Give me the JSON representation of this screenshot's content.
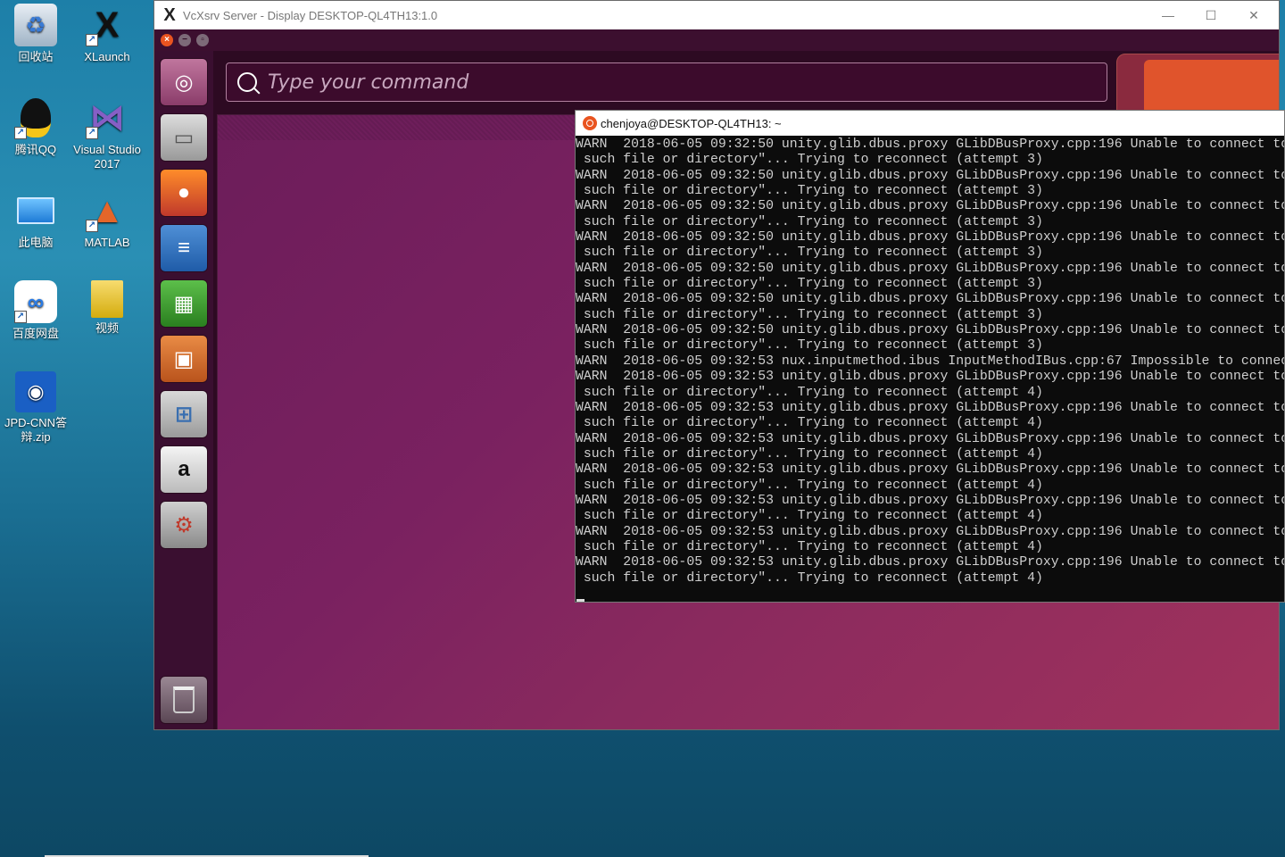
{
  "desktop": {
    "icons": [
      {
        "label": "回收站",
        "icon": "recycle-bin-icon"
      },
      {
        "label": "XLaunch",
        "icon": "xlaunch-icon"
      },
      {
        "label": "腾讯QQ",
        "icon": "qq-penguin-icon"
      },
      {
        "label": "Visual Studio 2017",
        "icon": "visual-studio-icon"
      },
      {
        "label": "此电脑",
        "icon": "this-pc-icon"
      },
      {
        "label": "MATLAB",
        "icon": "matlab-icon"
      },
      {
        "label": "百度网盘",
        "icon": "baidu-netdisk-icon"
      },
      {
        "label": "视频",
        "icon": "video-folder-icon"
      },
      {
        "label": "JPD-CNN答辩.zip",
        "icon": "zip-archive-icon"
      }
    ]
  },
  "vcxsrv": {
    "title": "VcXsrv Server - Display DESKTOP-QL4TH13:1.0",
    "minimize": "—",
    "maximize": "☐",
    "close": "✕"
  },
  "ubuntu": {
    "search_placeholder": "Type your command",
    "launcher": [
      {
        "name": "ubuntu-dash-icon",
        "glyph": "◎"
      },
      {
        "name": "files-icon",
        "glyph": "▭"
      },
      {
        "name": "firefox-icon",
        "glyph": "●"
      },
      {
        "name": "writer-icon",
        "glyph": "≡"
      },
      {
        "name": "calc-icon",
        "glyph": "▦"
      },
      {
        "name": "impress-icon",
        "glyph": "▣"
      },
      {
        "name": "software-center-icon",
        "glyph": "⊞"
      },
      {
        "name": "amazon-icon",
        "glyph": "a"
      },
      {
        "name": "system-settings-icon",
        "glyph": "⚙"
      },
      {
        "name": "trash-icon",
        "glyph": "🗑"
      }
    ]
  },
  "terminal": {
    "title": "chenjoya@DESKTOP-QL4TH13: ~",
    "lines": [
      "WARN  2018-06-05 09:32:50 unity.glib.dbus.proxy GLibDBusProxy.cpp:196 Unable to connect to prox",
      " such file or directory\"... Trying to reconnect (attempt 3)",
      "WARN  2018-06-05 09:32:50 unity.glib.dbus.proxy GLibDBusProxy.cpp:196 Unable to connect to prox",
      " such file or directory\"... Trying to reconnect (attempt 3)",
      "WARN  2018-06-05 09:32:50 unity.glib.dbus.proxy GLibDBusProxy.cpp:196 Unable to connect to prox",
      " such file or directory\"... Trying to reconnect (attempt 3)",
      "WARN  2018-06-05 09:32:50 unity.glib.dbus.proxy GLibDBusProxy.cpp:196 Unable to connect to prox",
      " such file or directory\"... Trying to reconnect (attempt 3)",
      "WARN  2018-06-05 09:32:50 unity.glib.dbus.proxy GLibDBusProxy.cpp:196 Unable to connect to prox",
      " such file or directory\"... Trying to reconnect (attempt 3)",
      "WARN  2018-06-05 09:32:50 unity.glib.dbus.proxy GLibDBusProxy.cpp:196 Unable to connect to prox",
      " such file or directory\"... Trying to reconnect (attempt 3)",
      "WARN  2018-06-05 09:32:50 unity.glib.dbus.proxy GLibDBusProxy.cpp:196 Unable to connect to prox",
      " such file or directory\"... Trying to reconnect (attempt 3)",
      "WARN  2018-06-05 09:32:53 nux.inputmethod.ibus InputMethodIBus.cpp:67 Impossible to connect to",
      "WARN  2018-06-05 09:32:53 unity.glib.dbus.proxy GLibDBusProxy.cpp:196 Unable to connect to prox",
      " such file or directory\"... Trying to reconnect (attempt 4)",
      "WARN  2018-06-05 09:32:53 unity.glib.dbus.proxy GLibDBusProxy.cpp:196 Unable to connect to prox",
      " such file or directory\"... Trying to reconnect (attempt 4)",
      "WARN  2018-06-05 09:32:53 unity.glib.dbus.proxy GLibDBusProxy.cpp:196 Unable to connect to prox",
      " such file or directory\"... Trying to reconnect (attempt 4)",
      "WARN  2018-06-05 09:32:53 unity.glib.dbus.proxy GLibDBusProxy.cpp:196 Unable to connect to prox",
      " such file or directory\"... Trying to reconnect (attempt 4)",
      "WARN  2018-06-05 09:32:53 unity.glib.dbus.proxy GLibDBusProxy.cpp:196 Unable to connect to prox",
      " such file or directory\"... Trying to reconnect (attempt 4)",
      "WARN  2018-06-05 09:32:53 unity.glib.dbus.proxy GLibDBusProxy.cpp:196 Unable to connect to prox",
      " such file or directory\"... Trying to reconnect (attempt 4)",
      "WARN  2018-06-05 09:32:53 unity.glib.dbus.proxy GLibDBusProxy.cpp:196 Unable to connect to prox",
      " such file or directory\"... Trying to reconnect (attempt 4)"
    ]
  },
  "colors": {
    "ubuntu_orange": "#e95420",
    "ubuntu_purple": "#2d0a22",
    "terminal_bg": "#0c0c0c"
  }
}
